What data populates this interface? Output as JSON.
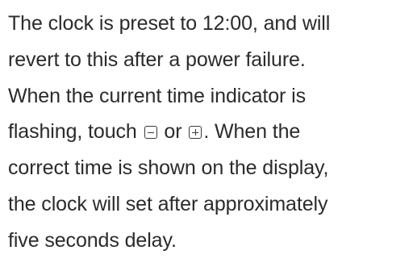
{
  "paragraph": {
    "line1": "The clock is preset to 12:00, and will",
    "line2": "revert to this after a power failure.",
    "line3": "When the current time indicator is",
    "line4_before": "flashing, touch ",
    "line4_middle": " or ",
    "line4_after": ".  When the",
    "line5": "correct time is shown on the display,",
    "line6": "the clock will set after approximately",
    "line7": "five seconds delay.",
    "icons": {
      "minus": "minus-key-icon",
      "plus": "plus-key-icon"
    }
  }
}
